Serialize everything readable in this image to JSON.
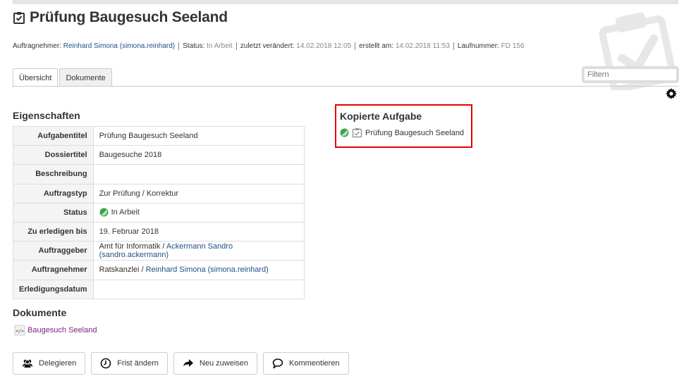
{
  "page": {
    "title": "Prüfung Baugesuch Seeland",
    "title_icon": "task-icon"
  },
  "meta": {
    "auftragnehmer_label": "Auftragnehmer:",
    "auftragnehmer_value": "Reinhard Simona (simona.reinhard)",
    "status_label": "Status:",
    "status_value": "In Arbeit",
    "modified_label": "zuletzt verändert:",
    "modified_value": "14.02.2018 12:05",
    "created_label": "erstellt am:",
    "created_value": "14.02.2018 11:53",
    "number_label": "Laufnummer:",
    "number_value": "FD 156"
  },
  "tabs": [
    {
      "label": "Übersicht",
      "active": true
    },
    {
      "label": "Dokumente",
      "active": false
    }
  ],
  "filter": {
    "placeholder": "Filtern"
  },
  "properties": {
    "heading": "Eigenschaften",
    "rows": [
      {
        "key": "Aufgabentitel",
        "value": "Prüfung Baugesuch Seeland"
      },
      {
        "key": "Dossiertitel",
        "value": "Baugesuche 2018"
      },
      {
        "key": "Beschreibung",
        "value": ""
      },
      {
        "key": "Auftragstyp",
        "value": "Zur Prüfung / Korrektur"
      },
      {
        "key": "Status",
        "value": "In Arbeit"
      },
      {
        "key": "Zu erledigen bis",
        "value": "19. Februar 2018"
      },
      {
        "key": "Auftraggeber",
        "value_prefix": "Amt für Informatik / ",
        "value_link": "Ackermann Sandro (sandro.ackermann)"
      },
      {
        "key": "Auftragnehmer",
        "value_prefix": "Ratskanzlei / ",
        "value_link": "Reinhard Simona (simona.reinhard)"
      },
      {
        "key": "Erledigungsdatum",
        "value": ""
      }
    ]
  },
  "documents": {
    "heading": "Dokumente",
    "items": [
      {
        "label": "Baugesuch Seeland",
        "icon": "xml-document-icon"
      }
    ]
  },
  "copied_task": {
    "heading": "Kopierte Aufgabe",
    "item_label": "Prüfung Baugesuch Seeland"
  },
  "buttons": [
    {
      "label": "Delegieren",
      "icon": "users-icon"
    },
    {
      "label": "Frist ändern",
      "icon": "clock-icon"
    },
    {
      "label": "Neu zuweisen",
      "icon": "arrow-right-icon"
    },
    {
      "label": "Kommentieren",
      "icon": "comment-icon"
    }
  ],
  "colors": {
    "accent_link": "#1f4f82",
    "document_link": "#7a1f7a",
    "status_green": "#3aa54a",
    "highlight_border": "#e60000"
  }
}
